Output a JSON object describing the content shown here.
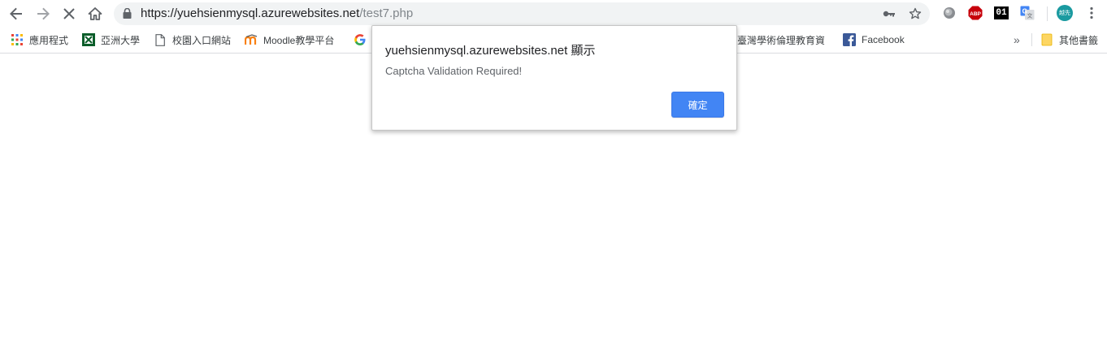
{
  "address_bar": {
    "host": "https://yuehsienmysql.azurewebsites.net",
    "path": "/test7.php"
  },
  "profile": {
    "initials": "越先",
    "color": "#1a9aa0"
  },
  "bookmarks": {
    "items": [
      {
        "label": "應用程式",
        "icon": "apps-grid-icon"
      },
      {
        "label": "亞洲大學",
        "icon": "asia-university-icon"
      },
      {
        "label": "校園入口網站",
        "icon": "page-icon"
      },
      {
        "label": "Moodle教學平台",
        "icon": "moodle-icon"
      },
      {
        "label": "",
        "icon": "google-icon"
      },
      {
        "label": "臺灣學術倫理教育資",
        "icon": ""
      },
      {
        "label": "Facebook",
        "icon": "facebook-icon"
      }
    ],
    "overflow": "»",
    "other": "其他書籤"
  },
  "dialog": {
    "title": "yuehsienmysql.azurewebsites.net 顯示",
    "message": "Captcha Validation Required!",
    "ok_label": "確定",
    "button_color": "#4285f4"
  },
  "extensions": {
    "abp_label": "ABP",
    "ext01_label": "01"
  }
}
